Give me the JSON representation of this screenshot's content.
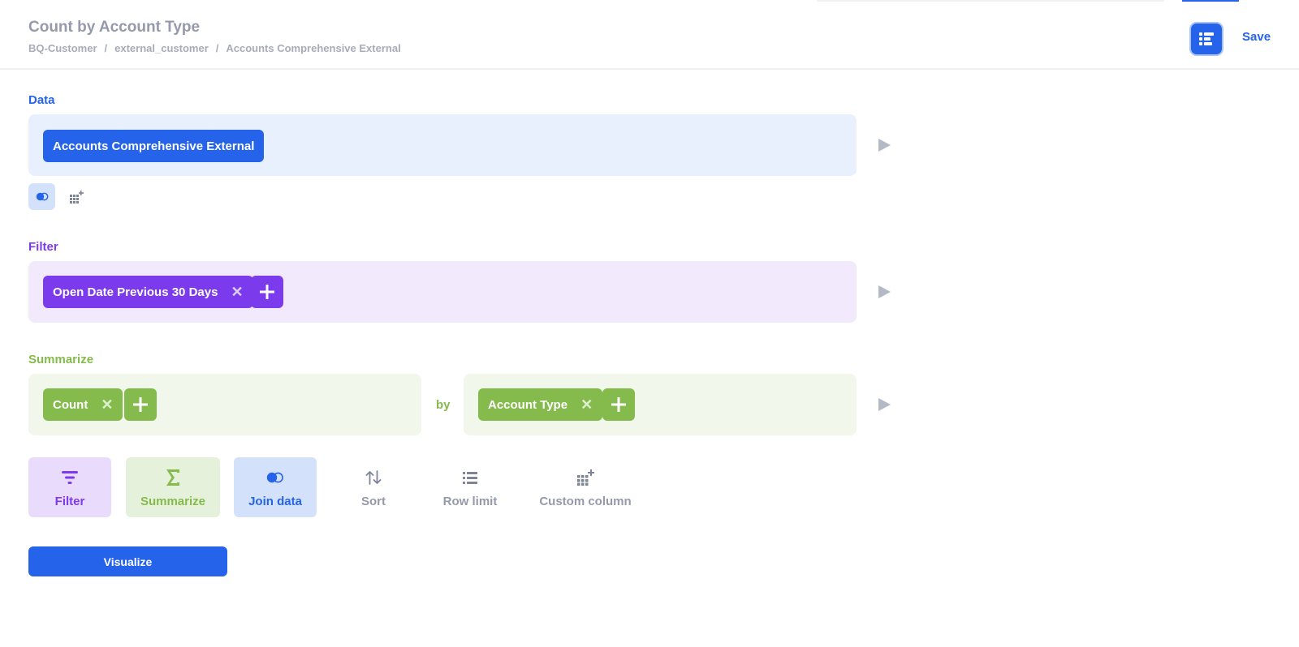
{
  "header": {
    "title": "Count by Account Type",
    "breadcrumb": [
      "BQ-Customer",
      "external_customer",
      "Accounts Comprehensive External"
    ],
    "breadcrumb_separator": "/",
    "save_label": "Save",
    "notebook_icon": "notebook-list-icon"
  },
  "data_step": {
    "label": "Data",
    "table_name": "Accounts Comprehensive External",
    "join_icon": "join-icon",
    "custom_column_icon": "custom-column-icon"
  },
  "filter_step": {
    "label": "Filter",
    "filters": [
      "Open Date Previous 30 Days"
    ],
    "remove_glyph": "✕",
    "add_glyph": "+"
  },
  "summarize_step": {
    "label": "Summarize",
    "metrics": [
      "Count"
    ],
    "by_label": "by",
    "breakouts": [
      "Account Type"
    ],
    "remove_glyph": "✕",
    "add_glyph": "+"
  },
  "actions": [
    {
      "label": "Filter",
      "icon": "filter-icon"
    },
    {
      "label": "Summarize",
      "icon": "sigma-icon"
    },
    {
      "label": "Join data",
      "icon": "join-icon"
    },
    {
      "label": "Sort",
      "icon": "sort-icon"
    },
    {
      "label": "Row limit",
      "icon": "list-icon"
    },
    {
      "label": "Custom column",
      "icon": "custom-column-icon"
    }
  ],
  "visualize_label": "Visualize",
  "colors": {
    "brand": "#2563eb",
    "filter": "#7c3aed",
    "summarize": "#84bb4c",
    "data_bg": "#e8effd",
    "filter_bg": "#f2eafc",
    "summarize_bg": "#f1f7ea",
    "muted_text": "#949aab"
  }
}
